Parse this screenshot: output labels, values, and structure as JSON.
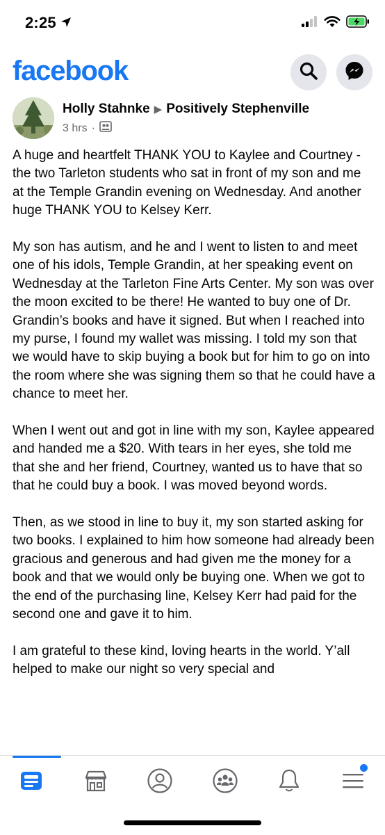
{
  "status": {
    "time": "2:25",
    "battery_color": "#4cd964"
  },
  "header": {
    "logo": "facebook",
    "brand_color": "#1877f2",
    "buttons": [
      {
        "icon": "search-icon"
      },
      {
        "icon": "messenger-icon"
      }
    ]
  },
  "post": {
    "author": "Holly Stahnke",
    "group": "Positively Stephenville",
    "time": "3 hrs",
    "separator": "·",
    "audience_icon": "group-icon",
    "paragraphs": [
      "A huge and heartfelt THANK YOU to Kaylee and Courtney - the two Tarleton students who sat in front of my son and me at the Temple Grandin evening on Wednesday. And another huge THANK YOU to Kelsey Kerr.",
      "My son has autism, and he and I went to listen to and meet one of his idols, Temple Grandin, at her speaking event on Wednesday at the Tarleton Fine Arts Center. My son was over the moon excited to be there! He wanted to buy one of Dr. Grandin’s books and have it signed. But when I reached into my purse, I found my wallet was missing. I told my son that we would have to skip buying a book but for him to go on into the room where she was signing them so that he could have a chance to meet her.",
      "When I went out and got in line with my son, Kaylee appeared and handed me a $20. With tears in her eyes, she told me that she and her friend, Courtney, wanted us to have that so that he could buy a book. I was moved beyond words.",
      "Then, as we stood in line to buy it, my son started asking for two books. I explained to him how someone had already been gracious and generous and had given me the money for a book and that we would only be buying one. When we got to the end of the purchasing line, Kelsey Kerr had paid for the second one and gave it to him.",
      "I am grateful to these kind, loving hearts in the world. Y’all helped to make our night so very special and"
    ]
  },
  "tabbar": {
    "tabs": [
      {
        "icon": "news-feed-icon",
        "active": true
      },
      {
        "icon": "marketplace-icon",
        "active": false
      },
      {
        "icon": "profile-icon",
        "active": false
      },
      {
        "icon": "groups-icon",
        "active": false
      },
      {
        "icon": "notifications-icon",
        "active": false
      },
      {
        "icon": "menu-icon",
        "active": false,
        "badge": true
      }
    ],
    "active_color": "#1877f2",
    "inactive_color": "#65676b"
  }
}
